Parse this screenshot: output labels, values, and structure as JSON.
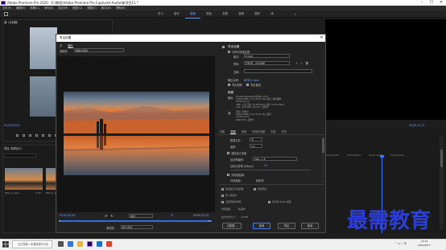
{
  "window": {
    "title": "Adobe Premiere Pro 2020 - E:\\教程\\Adobe Premiere Pro Captured Audio\\新项目11 *",
    "minimize": "–",
    "maximize": "☐",
    "close": "✕"
  },
  "menu": [
    "文件(F)",
    "编辑(E)",
    "剪辑(C)",
    "序列(S)",
    "标记(M)",
    "图形(G)",
    "视图(V)",
    "窗口(W)",
    "帮助(H)"
  ],
  "workspace_tabs": [
    {
      "label": "学习",
      "active": false
    },
    {
      "label": "组件",
      "active": false
    },
    {
      "label": "编辑",
      "active": true
    },
    {
      "label": "颜色",
      "active": false
    },
    {
      "label": "效果",
      "active": false
    },
    {
      "label": "音频",
      "active": false
    },
    {
      "label": "图形",
      "active": false
    },
    {
      "label": "库",
      "active": false
    }
  ],
  "workspace_more": "»",
  "source_panel": {
    "tab": "源: (无剪辑)",
    "timecode": "00;00;00;00"
  },
  "project_panel": {
    "tab": "项目: 新项目11",
    "clips": [
      {
        "name": "IMG_0_ease",
        "duration": "5;00"
      },
      {
        "name": "IMG_0_ease"
      }
    ]
  },
  "program_monitor": {
    "timecode": "00;00;12;12"
  },
  "timeline": {
    "ruler": [
      "00;00;04;00",
      "00;00;08;00",
      "00;00;12;00",
      "00;00;16;00"
    ]
  },
  "dialog": {
    "title": "导出设置",
    "close": "✕",
    "left_tabs": [
      {
        "label": "源",
        "active": false
      },
      {
        "label": "输出",
        "active": true
      }
    ],
    "source_scaling_label": "源缩放:",
    "source_scaling_value": "缩放以适合",
    "scrub": {
      "timecode_left": "00;00;00;00",
      "timecode_right": "00;00;12;12",
      "fit": "适合",
      "source_range_label": "源范围:",
      "source_range_value": "整个序列"
    },
    "export_settings": {
      "section_title": "导出设置",
      "match_sequence_label": "与序列设置匹配",
      "format_label": "格式:",
      "format_value": "H.264",
      "preset_label": "预设:",
      "preset_value": "匹配源 - 高比特率",
      "comments_label": "注释:",
      "output_name_label": "输出名称:",
      "output_name_value": "序列01.mp4",
      "export_video": "导出视频",
      "export_audio": "导出音频"
    },
    "summary": {
      "title": "摘要",
      "output_label": "输出:",
      "output_text": "E:\\Users\\Desktop\\序列01.mp4\n1920x1080 (1.0), 29.97 fps, 逐行, 软件编码\n00;00;12;12\nVBR, 1 次, 目标 10.00 Mbps, 最大 12.00 Mbps\nAAC, 320 kbps, 48 kHz, 立体声",
      "source_label": "源:",
      "source_text": "序列, 序列01\n1920x1080 (1.0), 29.97 fps, 逐行\n00;00;12;12\n48000 Hz, 立体声"
    },
    "tabs": [
      {
        "label": "效果",
        "active": false
      },
      {
        "label": "视频",
        "active": true
      },
      {
        "label": "音频",
        "active": false
      },
      {
        "label": "多路复用器",
        "active": false
      },
      {
        "label": "字幕",
        "active": false
      },
      {
        "label": "发布",
        "active": false
      }
    ],
    "video_rows": [
      {
        "label": "配置文件:",
        "value": "高"
      },
      {
        "label": "级别:",
        "value": "4.2"
      },
      {
        "label": "渲染最大深度",
        "value": ""
      },
      {
        "label": "比特率编码:",
        "value": "VBR, 1 次"
      },
      {
        "label": "目标比特率 [Mbps]:",
        "value": "10"
      },
      {
        "label": "关键帧距离:",
        "value": ""
      },
      {
        "label": "时间插值:",
        "value": "帧采样"
      }
    ],
    "bottom_options": [
      {
        "label": "使用最高渲染质量",
        "checked": false
      },
      {
        "label": "使用预览",
        "checked": false
      },
      {
        "label": "导入项目中",
        "checked": false
      },
      {
        "label": "设置开始时间码",
        "checked": false
      },
      {
        "label": "仅渲染 Alpha 通道",
        "checked": false
      }
    ],
    "time_interp_label": "时间插值:",
    "time_interp_value": "帧采样",
    "file_size_label": "估计文件大小:",
    "file_size_value": "16 MB",
    "buttons": {
      "metadata": "元数据...",
      "queue": "队列",
      "export": "导出",
      "cancel": "取消"
    }
  },
  "watermark": "最需教育",
  "taskbar": {
    "search_placeholder": "在这里输入你要搜索的内容",
    "time": "12:21",
    "date": "2021/8/17"
  },
  "colors": {
    "accent_blue": "#3d7bff",
    "watermark_blue": "#2b3fd8"
  }
}
